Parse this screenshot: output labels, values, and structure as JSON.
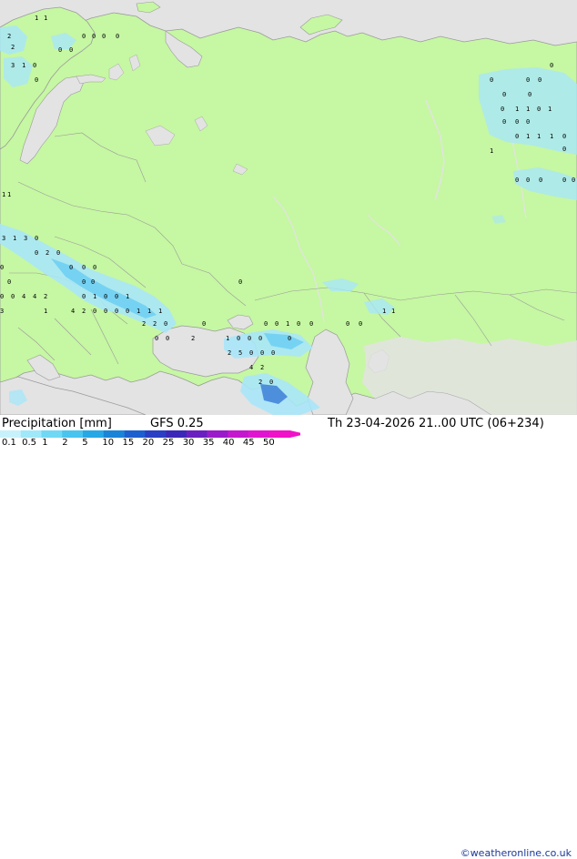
{
  "legend": {
    "title": "Precipitation [mm]",
    "model": "GFS 0.25",
    "valid_time": "Th 23-04-2026 21..00 UTC (06+234)",
    "ticks": [
      "0.1",
      "0.5",
      "1",
      "2",
      "5",
      "10",
      "15",
      "20",
      "25",
      "30",
      "35",
      "40",
      "45",
      "50"
    ],
    "colors": [
      "#c8f2fb",
      "#9ee8fa",
      "#6fd8f5",
      "#48c4ef",
      "#26a8e6",
      "#1a84d8",
      "#1e5fcf",
      "#2a3fc4",
      "#3a28b8",
      "#6a1fc0",
      "#9a1bc9",
      "#c418cf",
      "#e014d0",
      "#f012c8"
    ]
  },
  "credit": "©weatheronline.co.uk",
  "map": {
    "land_color": "#c6f7a3",
    "sea_color": "#e3e3e3",
    "border_color": "#999999",
    "precip_light_color": "#a8e6f8",
    "precip_mid_color": "#6fcff3",
    "precip_heavy_color": "#3d7fd8"
  },
  "values": [
    {
      "t": "1"
    },
    {
      "t": "1"
    },
    {
      "t": "2"
    },
    {
      "t": "0"
    },
    {
      "t": "0"
    },
    {
      "t": "0"
    },
    {
      "t": "0"
    },
    {
      "t": "2"
    },
    {
      "t": "0"
    },
    {
      "t": "0"
    },
    {
      "t": "3"
    },
    {
      "t": "1"
    },
    {
      "t": "0"
    },
    {
      "t": "0"
    },
    {
      "t": "0"
    },
    {
      "t": "0"
    },
    {
      "t": "0"
    },
    {
      "t": "0"
    },
    {
      "t": "0"
    },
    {
      "t": "0"
    },
    {
      "t": "1"
    },
    {
      "t": "1"
    },
    {
      "t": "0"
    },
    {
      "t": "1"
    },
    {
      "t": "0"
    },
    {
      "t": "0"
    },
    {
      "t": "0"
    },
    {
      "t": "0"
    },
    {
      "t": "0"
    },
    {
      "t": "1"
    },
    {
      "t": "1"
    },
    {
      "t": "1"
    },
    {
      "t": "0"
    },
    {
      "t": "0"
    },
    {
      "t": "1"
    },
    {
      "t": "0"
    },
    {
      "t": "0"
    },
    {
      "t": "0"
    },
    {
      "t": "0"
    },
    {
      "t": "0"
    },
    {
      "t": "1"
    },
    {
      "t": "1"
    },
    {
      "t": "3"
    },
    {
      "t": "1"
    },
    {
      "t": "3"
    },
    {
      "t": "0"
    },
    {
      "t": "0"
    },
    {
      "t": "2"
    },
    {
      "t": "0"
    },
    {
      "t": "0"
    },
    {
      "t": "0"
    },
    {
      "t": "0"
    },
    {
      "t": "0"
    },
    {
      "t": "0"
    },
    {
      "t": "0"
    },
    {
      "t": "0"
    },
    {
      "t": "0"
    },
    {
      "t": "0"
    },
    {
      "t": "0"
    },
    {
      "t": "4"
    },
    {
      "t": "4"
    },
    {
      "t": "2"
    },
    {
      "t": "0"
    },
    {
      "t": "1"
    },
    {
      "t": "0"
    },
    {
      "t": "0"
    },
    {
      "t": "1"
    },
    {
      "t": "1"
    },
    {
      "t": "3"
    },
    {
      "t": "4"
    },
    {
      "t": "2"
    },
    {
      "t": "0"
    },
    {
      "t": "0"
    },
    {
      "t": "0"
    },
    {
      "t": "0"
    },
    {
      "t": "1"
    },
    {
      "t": "1"
    },
    {
      "t": "1"
    },
    {
      "t": "1"
    },
    {
      "t": "1"
    },
    {
      "t": "2"
    },
    {
      "t": "2"
    },
    {
      "t": "0"
    },
    {
      "t": "0"
    },
    {
      "t": "0"
    },
    {
      "t": "1"
    },
    {
      "t": "0"
    },
    {
      "t": "0"
    },
    {
      "t": "0"
    },
    {
      "t": "0"
    },
    {
      "t": "0"
    },
    {
      "t": "0"
    },
    {
      "t": "0"
    },
    {
      "t": "2"
    },
    {
      "t": "1"
    },
    {
      "t": "0"
    },
    {
      "t": "0"
    },
    {
      "t": "0"
    },
    {
      "t": "0"
    },
    {
      "t": "2"
    },
    {
      "t": "5"
    },
    {
      "t": "0"
    },
    {
      "t": "0"
    },
    {
      "t": "0"
    },
    {
      "t": "4"
    },
    {
      "t": "2"
    },
    {
      "t": "2"
    },
    {
      "t": "0"
    }
  ]
}
